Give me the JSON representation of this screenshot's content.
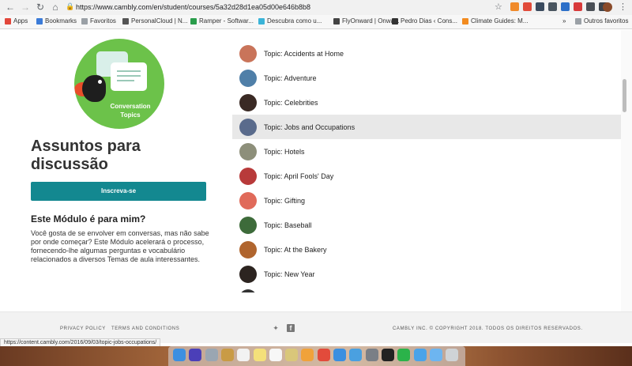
{
  "browser": {
    "url_prefix": "https://",
    "url_host": "www.cambly.com",
    "url_path": "/en/student/courses/5a32d28d1ea05d00e646b8b8",
    "bookmarks": [
      {
        "label": "Apps",
        "icon": "apps-grid-icon",
        "color": "#e2473b"
      },
      {
        "label": "Bookmarks",
        "icon": "star-icon",
        "color": "#3b7bd8"
      },
      {
        "label": "Favoritos",
        "icon": "folder-icon",
        "color": "#9aa0a6"
      },
      {
        "label": "PersonalCloud | N...",
        "icon": "cloud-icon",
        "color": "#555555"
      },
      {
        "label": "Ramper - Softwar...",
        "icon": "ramper-icon",
        "color": "#2a9d4b"
      },
      {
        "label": "Descubra como u...",
        "icon": "info-icon",
        "color": "#3bb4d8"
      },
      {
        "label": "FlyOnward | Onwa...",
        "icon": "plane-icon",
        "color": "#444444"
      },
      {
        "label": "Pedro Dias ‹ Cons...",
        "icon": "pen-icon",
        "color": "#333333"
      },
      {
        "label": "Climate Guides: M...",
        "icon": "climate-icon",
        "color": "#f28b20"
      }
    ],
    "other_bookmarks": "Outros favoritos",
    "status_url": "https://content.cambly.com/2016/09/03/topic-jobs-occupations/"
  },
  "sidebar": {
    "logo_text_line1": "Conversation",
    "logo_text_line2": "Topics",
    "title": "Assuntos para discussão",
    "subscribe_label": "Inscreva-se",
    "module_heading": "Este Módulo é para mim?",
    "module_text": "Você gosta de se envolver em conversas, mas não sabe por onde começar? Este Módulo acelerará o processo, fornecendo-lhe algumas perguntas e vocabulário relacionados a diversos Temas de aula interessantes."
  },
  "topics": [
    {
      "label": "Topic: Accidents at Home",
      "thumb": "#c9745a",
      "active": false
    },
    {
      "label": "Topic: Adventure",
      "thumb": "#4f7fa8",
      "active": false
    },
    {
      "label": "Topic: Celebrities",
      "thumb": "#3a2a24",
      "active": false
    },
    {
      "label": "Topic: Jobs and Occupations",
      "thumb": "#5a6b8c",
      "active": true
    },
    {
      "label": "Topic: Hotels",
      "thumb": "#8d8f7a",
      "active": false
    },
    {
      "label": "Topic: April Fools' Day",
      "thumb": "#b83a3a",
      "active": false
    },
    {
      "label": "Topic: Gifting",
      "thumb": "#e06a5a",
      "active": false
    },
    {
      "label": "Topic: Baseball",
      "thumb": "#3d6b3a",
      "active": false
    },
    {
      "label": "Topic: At the Bakery",
      "thumb": "#b0652e",
      "active": false
    },
    {
      "label": "Topic: New Year",
      "thumb": "#2c2420",
      "active": false
    }
  ],
  "footer": {
    "privacy": "PRIVACY POLICY",
    "terms": "TERMS AND CONDITIONS",
    "copyright": "CAMBLY INC. © COPYRIGHT 2018. TODOS OS DIREITOS RESERVADOS."
  },
  "colors": {
    "accent": "#138890",
    "logo_green": "#6cc24a",
    "active_row": "#e8e8e8"
  },
  "dock_icons": [
    {
      "name": "finder-icon",
      "color": "#3d8fe0"
    },
    {
      "name": "siri-icon",
      "color": "#4b3fb8"
    },
    {
      "name": "launchpad-icon",
      "color": "#9aa6b2"
    },
    {
      "name": "notes-folder-icon",
      "color": "#c99b45"
    },
    {
      "name": "calendar-icon",
      "color": "#f2f2f2"
    },
    {
      "name": "notes-icon",
      "color": "#f4e07a"
    },
    {
      "name": "stickies-icon",
      "color": "#f7f7f7"
    },
    {
      "name": "preview-icon",
      "color": "#d9c77a"
    },
    {
      "name": "photos-icon",
      "color": "#f0a23a"
    },
    {
      "name": "chrome-icon",
      "color": "#e24b3b"
    },
    {
      "name": "safari-icon",
      "color": "#3a8fe0"
    },
    {
      "name": "mail-icon",
      "color": "#4aa0e0"
    },
    {
      "name": "system-preferences-icon",
      "color": "#7a7f86"
    },
    {
      "name": "terminal-icon",
      "color": "#222222"
    },
    {
      "name": "whatsapp-icon",
      "color": "#2bb34a"
    },
    {
      "name": "downloads-folder-icon",
      "color": "#4aa3e8"
    },
    {
      "name": "documents-folder-icon",
      "color": "#6db5f0"
    },
    {
      "name": "trash-icon",
      "color": "#cfd3d6"
    }
  ]
}
